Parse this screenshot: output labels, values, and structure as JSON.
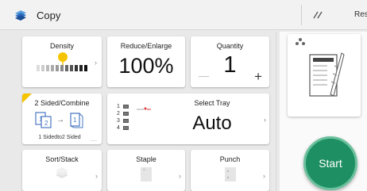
{
  "header": {
    "app_title": "Copy",
    "reset_label": "Reset",
    "app_icon": "copy-app-icon",
    "clear_icon": "clear-settings-icon"
  },
  "tiles": {
    "density": {
      "label": "Density",
      "level": 0.5
    },
    "reduce_enlarge": {
      "label": "Reduce/Enlarge",
      "value": "100%"
    },
    "quantity": {
      "label": "Quantity",
      "value": "1",
      "minus": "—",
      "plus": "+"
    },
    "duplex": {
      "label": "2 Sided/Combine",
      "sub": "1 Sidedto2 Sided",
      "dots": "..."
    },
    "tray": {
      "label": "Select Tray",
      "value": "Auto",
      "trays": [
        "1",
        "2",
        "3",
        "4"
      ]
    },
    "sort": {
      "label": "Sort/Stack"
    },
    "staple": {
      "label": "Staple"
    },
    "punch": {
      "label": "Punch"
    }
  },
  "start": {
    "label": "Start"
  },
  "colors": {
    "accent": "#1e8f63",
    "density_marker": "#f5c400"
  }
}
